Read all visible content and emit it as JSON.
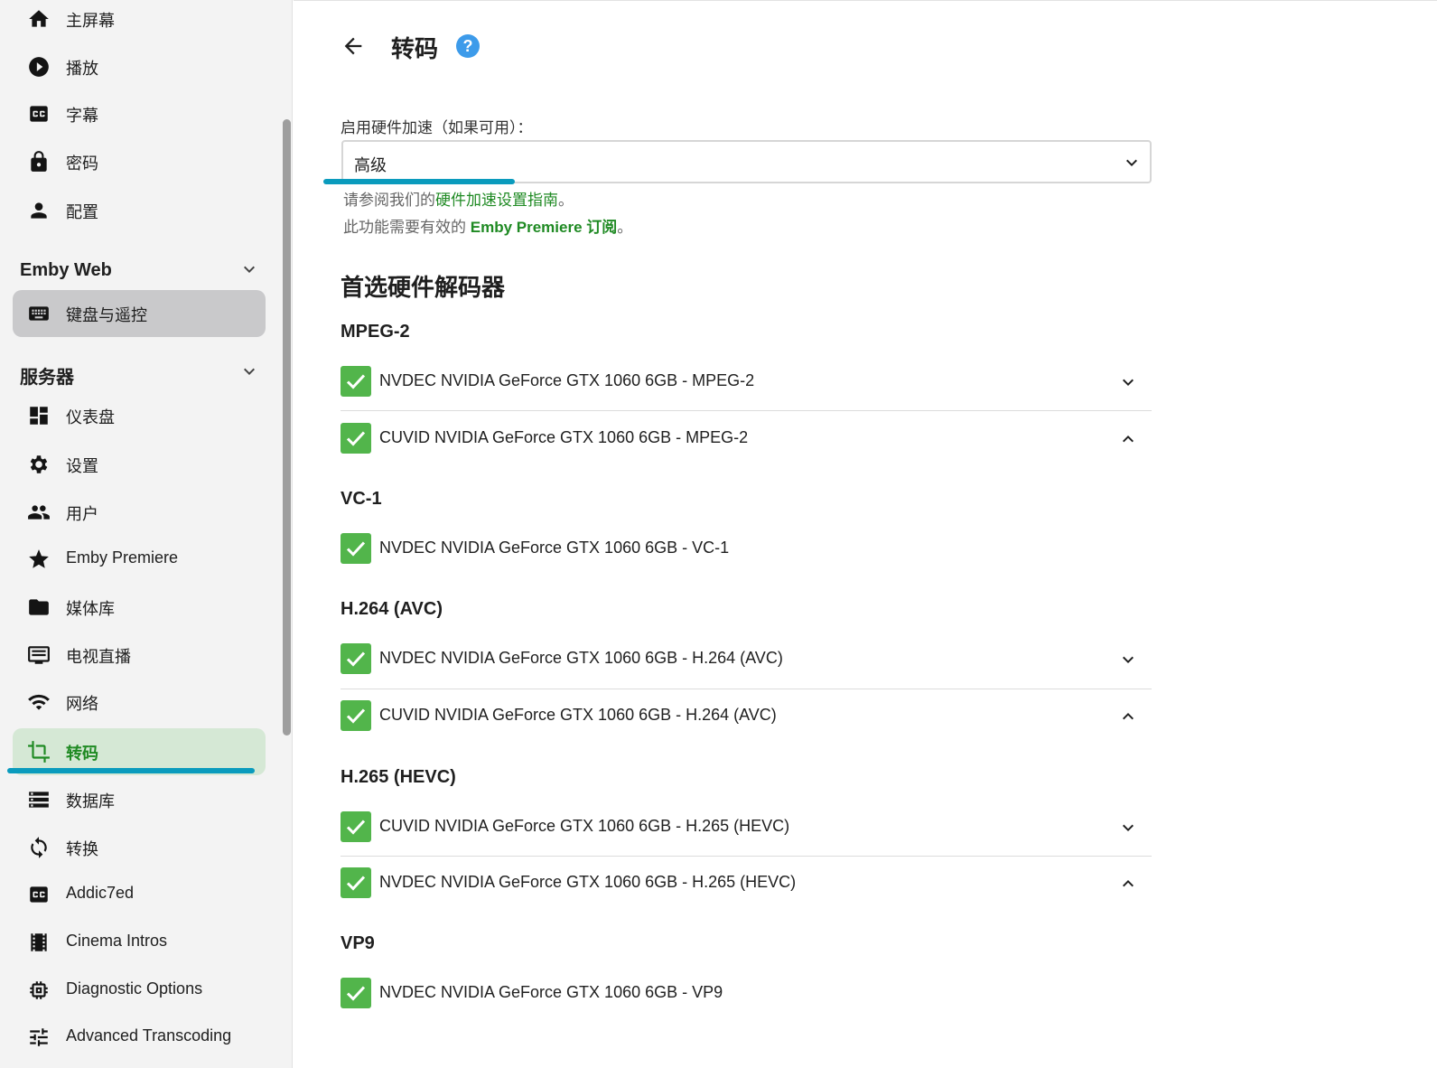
{
  "sidebar": {
    "top_items": [
      {
        "label": "主屏幕",
        "icon": "home-icon"
      },
      {
        "label": "播放",
        "icon": "play-circle-icon"
      },
      {
        "label": "字幕",
        "icon": "closed-caption-icon"
      },
      {
        "label": "密码",
        "icon": "lock-icon"
      },
      {
        "label": "配置",
        "icon": "person-icon"
      }
    ],
    "emby_web": {
      "title": "Emby Web",
      "items": [
        {
          "label": "键盘与遥控",
          "icon": "keyboard-icon"
        }
      ]
    },
    "server": {
      "title": "服务器",
      "items": [
        {
          "label": "仪表盘",
          "icon": "dashboard-icon"
        },
        {
          "label": "设置",
          "icon": "gear-icon"
        },
        {
          "label": "用户",
          "icon": "people-icon"
        },
        {
          "label": "Emby Premiere",
          "icon": "star-icon"
        },
        {
          "label": "媒体库",
          "icon": "folder-icon"
        },
        {
          "label": "电视直播",
          "icon": "tv-guide-icon"
        },
        {
          "label": "网络",
          "icon": "wifi-icon"
        },
        {
          "label": "转码",
          "icon": "crop-icon"
        },
        {
          "label": "数据库",
          "icon": "storage-icon"
        },
        {
          "label": "转换",
          "icon": "sync-icon"
        },
        {
          "label": "Addic7ed",
          "icon": "closed-caption-icon"
        },
        {
          "label": "Cinema Intros",
          "icon": "film-icon"
        },
        {
          "label": "Diagnostic Options",
          "icon": "chip-icon"
        },
        {
          "label": "Advanced Transcoding",
          "icon": "tune-icon"
        }
      ]
    }
  },
  "page": {
    "title": "转码",
    "help_glyph": "?"
  },
  "hw_accel": {
    "label": "启用硬件加速（如果可用）：",
    "selected": "高级",
    "help_prefix": "请参阅我们的",
    "help_link": "硬件加速设置指南",
    "help_suffix": "。",
    "premiere_prefix": "此功能需要有效的 ",
    "premiere_link": "Emby Premiere 订阅",
    "premiere_suffix": "。"
  },
  "decoders": {
    "title": "首选硬件解码器",
    "groups": [
      {
        "codec": "MPEG-2",
        "items": [
          {
            "name": "NVDEC NVIDIA GeForce GTX 1060 6GB - MPEG-2",
            "checked": true,
            "toggle": "down"
          },
          {
            "name": "CUVID NVIDIA GeForce GTX 1060 6GB - MPEG-2",
            "checked": true,
            "toggle": "up"
          }
        ]
      },
      {
        "codec": "VC-1",
        "items": [
          {
            "name": "NVDEC NVIDIA GeForce GTX 1060 6GB - VC-1",
            "checked": true,
            "toggle": "none"
          }
        ]
      },
      {
        "codec": "H.264 (AVC)",
        "items": [
          {
            "name": "NVDEC NVIDIA GeForce GTX 1060 6GB - H.264 (AVC)",
            "checked": true,
            "toggle": "down"
          },
          {
            "name": "CUVID NVIDIA GeForce GTX 1060 6GB - H.264 (AVC)",
            "checked": true,
            "toggle": "up"
          }
        ]
      },
      {
        "codec": "H.265 (HEVC)",
        "items": [
          {
            "name": "CUVID NVIDIA GeForce GTX 1060 6GB - H.265 (HEVC)",
            "checked": true,
            "toggle": "down"
          },
          {
            "name": "NVDEC NVIDIA GeForce GTX 1060 6GB - H.265 (HEVC)",
            "checked": true,
            "toggle": "up"
          }
        ]
      },
      {
        "codec": "VP9",
        "items": [
          {
            "name": "NVDEC NVIDIA GeForce GTX 1060 6GB - VP9",
            "checked": true,
            "toggle": "none"
          }
        ]
      }
    ]
  },
  "colors": {
    "accent_green": "#1f8a23",
    "checkbox_green": "#52b54b",
    "highlight_underline": "#0a9bbd",
    "help_blue": "#3d9bea"
  }
}
